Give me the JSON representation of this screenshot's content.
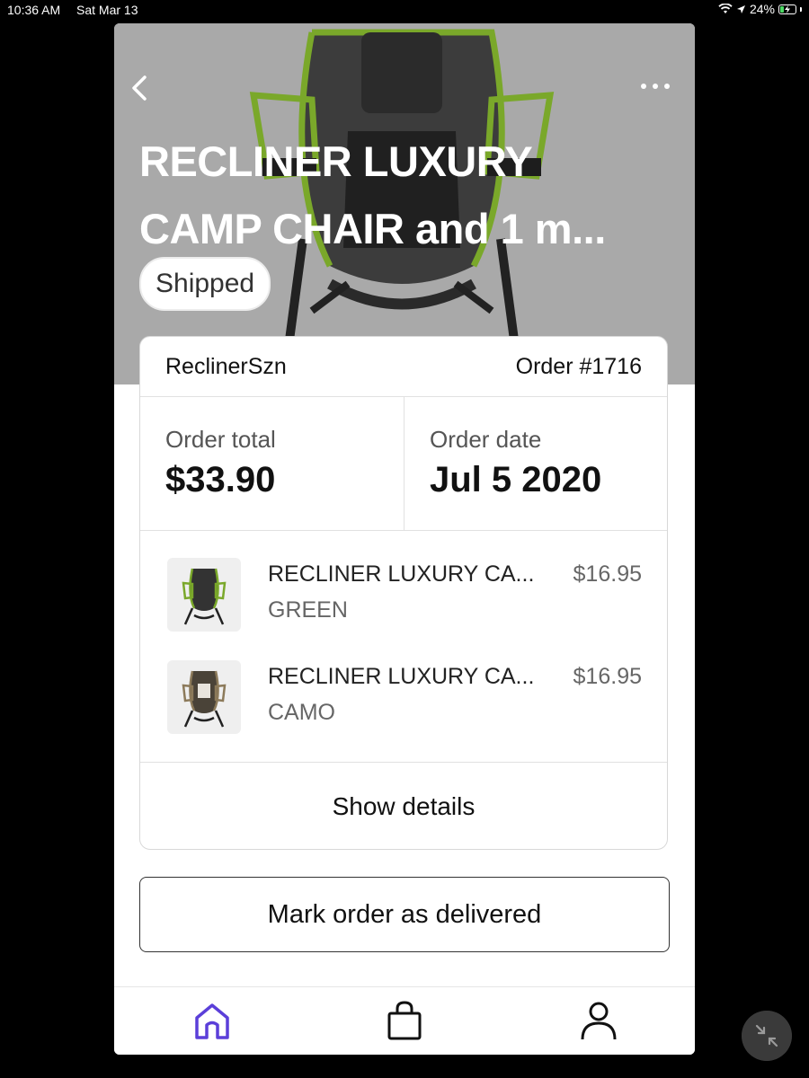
{
  "status_bar": {
    "time": "10:36 AM",
    "date": "Sat Mar 13",
    "battery": "24%"
  },
  "header": {
    "title_line1": "RECLINER LUXURY",
    "title_line2": "CAMP CHAIR and 1 m...",
    "status": "Shipped"
  },
  "order": {
    "store": "ReclinerSzn",
    "number": "Order #1716",
    "total_label": "Order total",
    "total_value": "$33.90",
    "date_label": "Order date",
    "date_value": "Jul 5 2020"
  },
  "items": [
    {
      "name": "RECLINER LUXURY CA...",
      "variant": "GREEN",
      "price": "$16.95"
    },
    {
      "name": "RECLINER LUXURY CA...",
      "variant": "CAMO",
      "price": "$16.95"
    }
  ],
  "actions": {
    "show_details": "Show details",
    "mark_delivered": "Mark order as delivered"
  },
  "tabs": [
    "home-icon",
    "shopping-bag-icon",
    "profile-icon"
  ],
  "colors": {
    "accent": "#5b3fd9",
    "hero_background": "#a9a9a9",
    "chair_frame": "#7aa82a"
  }
}
